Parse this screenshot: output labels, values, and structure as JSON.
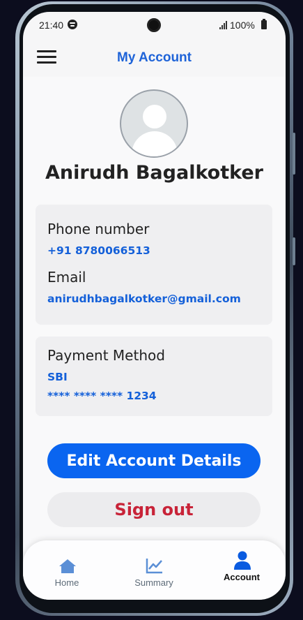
{
  "status_bar": {
    "time": "21:40",
    "battery": "100%",
    "icons": [
      "spotify-icon",
      "camera-icon",
      "signal-icon",
      "battery-icon"
    ]
  },
  "header": {
    "title": "My Account",
    "menu_icon": "hamburger-menu-icon"
  },
  "profile": {
    "avatar_icon": "user-avatar-icon",
    "name": "Anirudh Bagalkotker"
  },
  "contact_card": {
    "phone_label": "Phone number",
    "phone_value": "+91 8780066513",
    "email_label": "Email",
    "email_value": "anirudhbagalkotker@gmail.com"
  },
  "payment_card": {
    "label": "Payment Method",
    "bank": "SBI",
    "card_number": "**** **** **** 1234"
  },
  "actions": {
    "edit_label": "Edit Account Details",
    "signout_label": "Sign out"
  },
  "bottom_nav": {
    "items": [
      {
        "label": "Home",
        "icon": "home-icon",
        "active": false
      },
      {
        "label": "Summary",
        "icon": "chart-icon",
        "active": false
      },
      {
        "label": "Account",
        "icon": "person-icon",
        "active": true
      }
    ]
  },
  "colors": {
    "accent": "#0a65f0",
    "link": "#1460d9",
    "danger": "#c82338",
    "nav_icon": "#5b8fd6",
    "nav_icon_active": "#0a5be0"
  }
}
